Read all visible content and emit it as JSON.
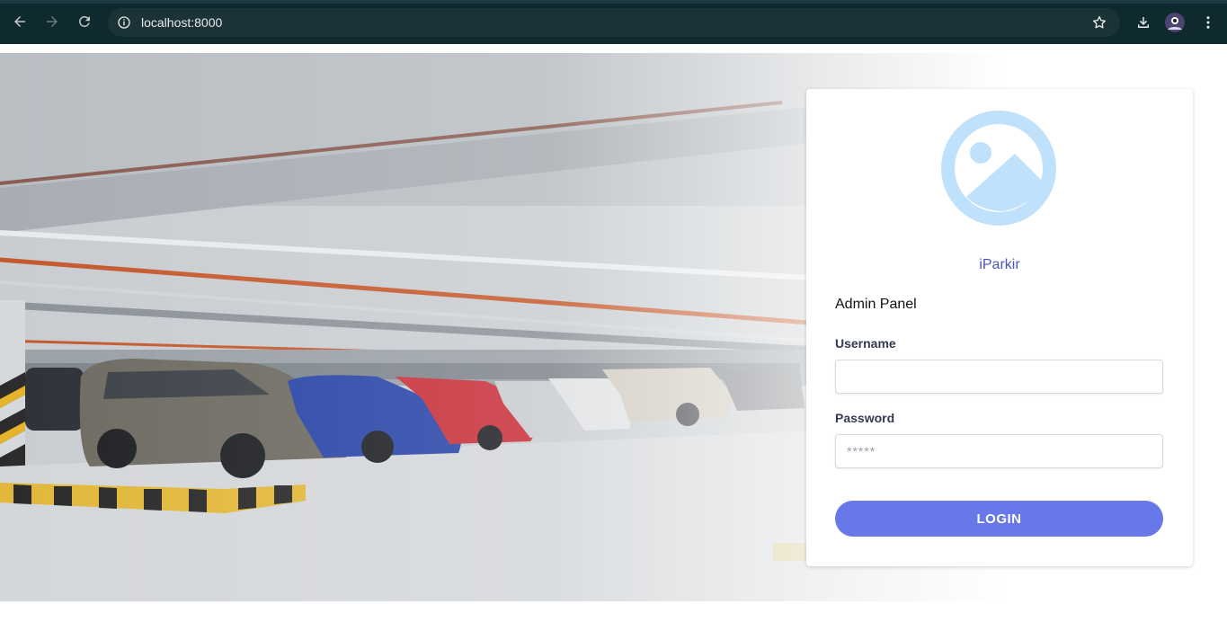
{
  "browser": {
    "url": "localhost:8000",
    "back_icon": "arrow-left-icon",
    "forward_icon": "arrow-right-icon",
    "reload_icon": "reload-icon",
    "info_icon": "info-icon",
    "bookmark_icon": "star-icon",
    "download_icon": "download-icon",
    "menu_icon": "kebab-menu-icon"
  },
  "login": {
    "app_name": "iParkir",
    "panel_title": "Admin Panel",
    "username_label": "Username",
    "username_value": "",
    "password_label": "Password",
    "password_placeholder": "*****",
    "login_label": "LOGIN"
  },
  "colors": {
    "chrome_bg": "#0f2a2e",
    "accent": "#6778e8",
    "brand_text": "#4b56b3",
    "logo_fill": "#bfe1fb"
  }
}
